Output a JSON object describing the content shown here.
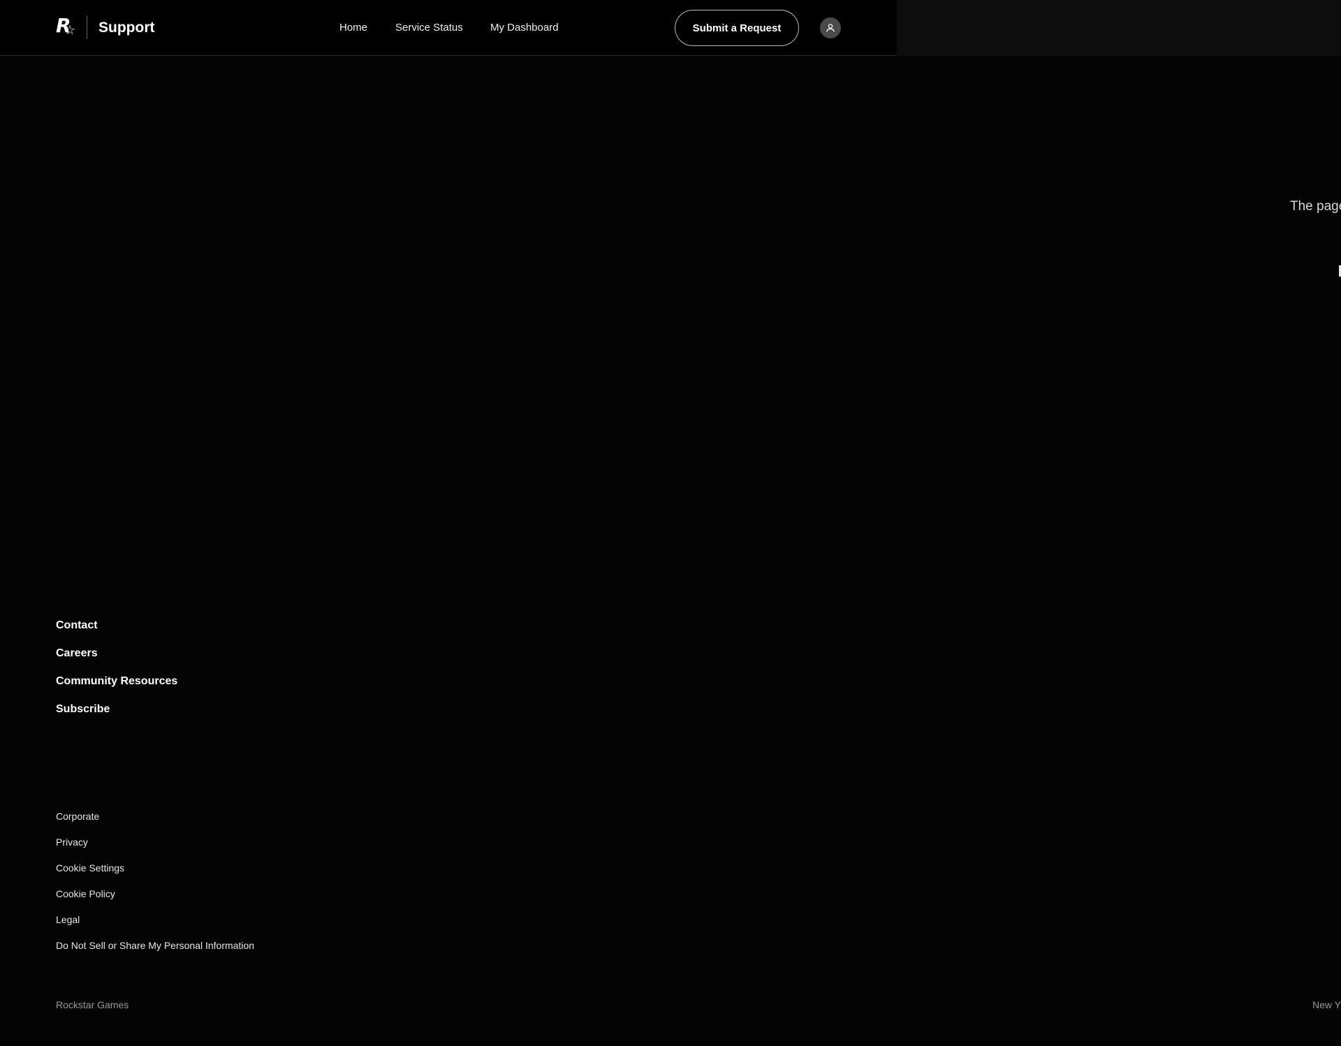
{
  "header": {
    "brand_mark": "R★",
    "brand_text": "Support",
    "nav": [
      {
        "label": "Home"
      },
      {
        "label": "Service Status"
      },
      {
        "label": "My Dashboard"
      }
    ],
    "cta_label": "Submit a Request",
    "avatar_icon": "user-icon"
  },
  "main": {
    "message": "The page"
  },
  "footer": {
    "primary_links": [
      {
        "label": "Contact"
      },
      {
        "label": "Careers"
      },
      {
        "label": "Community Resources"
      },
      {
        "label": "Subscribe"
      }
    ],
    "legal_links": [
      {
        "label": "Corporate"
      },
      {
        "label": "Privacy"
      },
      {
        "label": "Cookie Settings"
      },
      {
        "label": "Cookie Policy"
      },
      {
        "label": "Legal"
      },
      {
        "label": "Do Not Sell or Share My Personal Information"
      }
    ],
    "copyright": "Rockstar Games",
    "location": "New Y"
  },
  "colors": {
    "background": "#000000",
    "text": "#ffffff",
    "muted": "#9a9a9a"
  }
}
